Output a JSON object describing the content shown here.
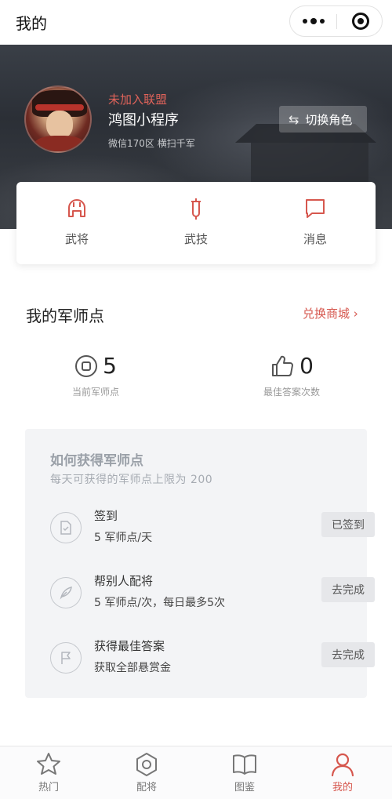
{
  "header": {
    "title": "我的"
  },
  "profile": {
    "alliance_status": "未加入联盟",
    "nickname": "鸿图小程序",
    "server_info": "微信170区 横扫千军",
    "switch_role_label": "切换角色"
  },
  "quick_nav": [
    {
      "label": "武将",
      "icon": "helmet-icon"
    },
    {
      "label": "武技",
      "icon": "sword-icon"
    },
    {
      "label": "消息",
      "icon": "message-icon"
    }
  ],
  "points": {
    "section_title": "我的军师点",
    "exchange_link": "兑换商城",
    "current_value": "5",
    "current_label": "当前军师点",
    "best_answer_value": "0",
    "best_answer_label": "最佳答案次数"
  },
  "earn": {
    "title": "如何获得军师点",
    "subtitle": "每天可获得的军师点上限为 200",
    "tasks": [
      {
        "name": "签到",
        "desc": "5 军师点/天",
        "button": "已签到",
        "icon": "checkin-doc-icon"
      },
      {
        "name": "帮别人配将",
        "desc": "5 军师点/次，每日最多5次",
        "button": "去完成",
        "icon": "feather-icon"
      },
      {
        "name": "获得最佳答案",
        "desc": "获取全部悬赏金",
        "button": "去完成",
        "icon": "flag-icon"
      }
    ]
  },
  "tabbar": [
    {
      "label": "热门",
      "icon": "star-icon"
    },
    {
      "label": "配将",
      "icon": "hexagon-icon"
    },
    {
      "label": "图鉴",
      "icon": "book-icon"
    },
    {
      "label": "我的",
      "icon": "person-icon",
      "active": true
    }
  ],
  "colors": {
    "accent": "#d6574e",
    "alliance": "#e0635a"
  }
}
